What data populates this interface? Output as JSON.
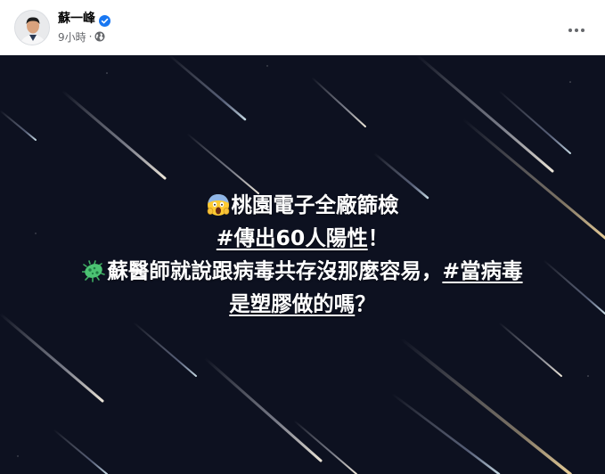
{
  "author": {
    "name": "蘇一峰",
    "verified": true
  },
  "meta": {
    "time": "9小時",
    "separator": "·",
    "audience_icon": "globe-icon"
  },
  "header": {
    "more_icon": "more-horizontal-icon"
  },
  "image": {
    "background_color": "#0d1120",
    "lines": [
      {
        "emoji": "face-screaming-in-fear",
        "parts": [
          {
            "text": "桃園電子全廠篩檢",
            "hashtag": false
          }
        ]
      },
      {
        "emoji": null,
        "parts": [
          {
            "text": "#傳出60人陽性",
            "hashtag": true
          },
          {
            "text": "！",
            "hashtag": false
          }
        ]
      },
      {
        "emoji": "microbe",
        "parts": [
          {
            "text": "蘇醫師就說跟病毒共存沒那麼容易，",
            "hashtag": false
          },
          {
            "text": "#當病毒",
            "hashtag": true
          }
        ]
      },
      {
        "emoji": null,
        "parts": [
          {
            "text": "是塑膠做的嗎",
            "hashtag": true
          },
          {
            "text": "？",
            "hashtag": false
          }
        ]
      }
    ]
  }
}
